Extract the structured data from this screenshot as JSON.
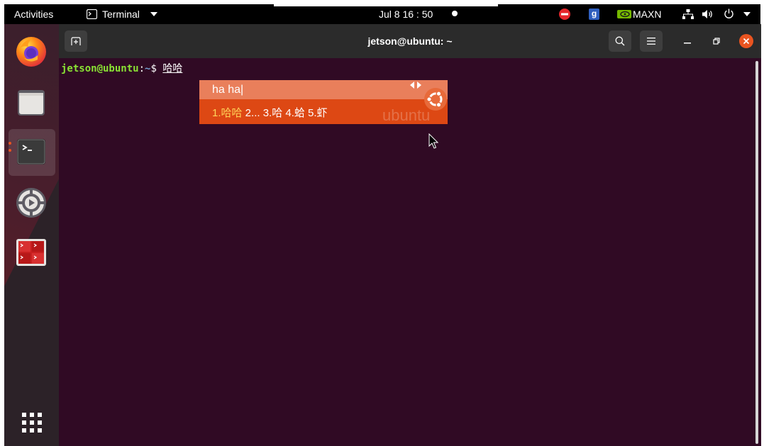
{
  "topbar": {
    "activities": "Activities",
    "app_menu": "Terminal",
    "clock": "Jul 8  16 : 50",
    "power_mode": "MAXN",
    "indicator_g": "g"
  },
  "window": {
    "title": "jetson@ubuntu: ~"
  },
  "terminal": {
    "prompt_user": "jetson@ubuntu",
    "prompt_sep": ":",
    "prompt_path": "~",
    "prompt_symbol": "$",
    "preedit": "哈哈"
  },
  "ime": {
    "input": "ha ha|",
    "cand_1": "1.哈哈",
    "cand_rest": " 2... 3.哈 4.蛤 5.虾",
    "watermark": "ubuntu"
  },
  "colors": {
    "terminal_bg": "#300a24",
    "ime_bg": "#dd4814",
    "ime_top": "#e97f5b",
    "prompt_user": "#8ae234",
    "prompt_path": "#729fcf",
    "ubuntu_orange": "#e95420"
  }
}
